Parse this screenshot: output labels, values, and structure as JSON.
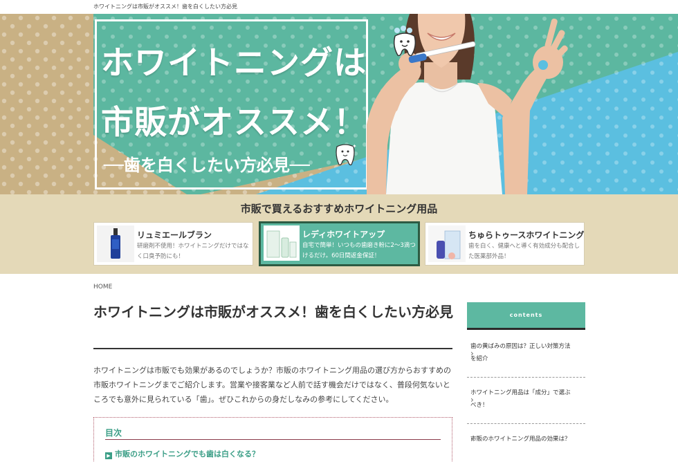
{
  "topbar": {
    "text": "ホワイトニングは市販がオススメ！歯を白くしたい方必見"
  },
  "hero": {
    "line1": "ホワイトニングは",
    "line2": "市販がオススメ！",
    "line3": "──歯を白くしたい方必見──"
  },
  "picks": {
    "title": "市販で買えるおすすめホワイトニング用品",
    "items": [
      {
        "name": "リュミエールブラン",
        "desc": "研磨剤不使用！ホワイトニングだけではなく口臭予防にも！"
      },
      {
        "name": "レディホワイトアップ",
        "desc": "自宅で簡単！いつもの歯磨き粉に2〜3滴つけるだけ。60日間返金保証！"
      },
      {
        "name": "ちゅらトゥースホワイトニング",
        "desc": "歯を白く、健康へと導く有効成分も配合した医薬部外品！"
      }
    ]
  },
  "breadcrumb": "HOME",
  "post": {
    "title": "ホワイトニングは市販がオススメ！歯を白くしたい方必見",
    "intro": "ホワイトニングは市販でも効果があるのでしょうか？市販のホワイトニング用品の選び方からおすすめの市販ホワイトニングまでご紹介します。営業や接客業など人前で話す機会だけではなく、普段何気ないところでも意外に見られている「歯」。ぜひこれからの身だしなみの参考にしてください。"
  },
  "toc": {
    "title": "目次",
    "items": [
      "市販のホワイトニングでも歯は白くなる？"
    ]
  },
  "sidebar": {
    "heading": "contents",
    "items": [
      "歯の黄ばみの原因は？正しい対策方法を紹介",
      "ホワイトニング用品は「成分」で選ぶべき！",
      "市販のホワイトニング用品の効果は？"
    ]
  },
  "colors": {
    "accent": "#5db8a1",
    "accent_dark": "#2d5b43",
    "beige": "#c9b184",
    "band": "#e4d9b8",
    "sky": "#5bbfe0"
  }
}
